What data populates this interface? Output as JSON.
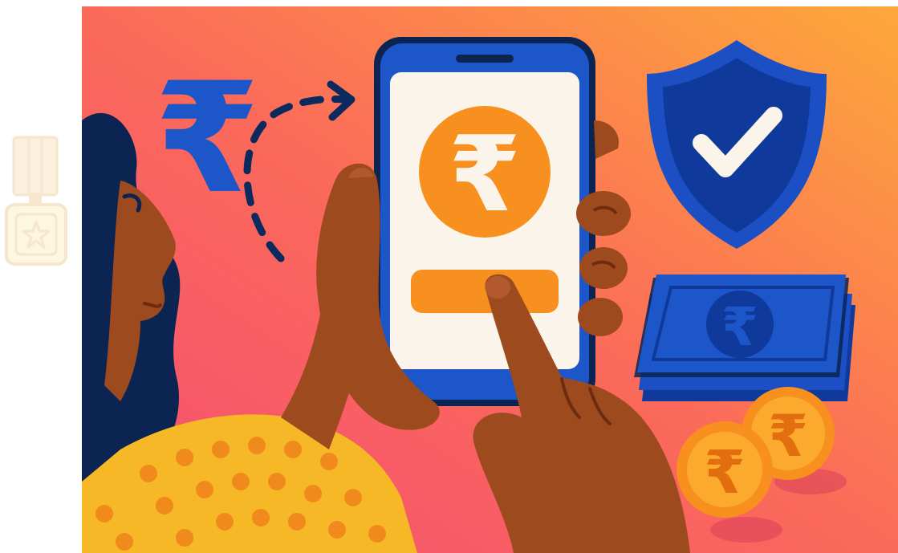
{
  "illustration": {
    "currency_symbol": "₹",
    "icons": {
      "rupee_symbol": "rupee-icon",
      "transfer_arrow": "dashed-arrow-icon",
      "shield_check": "shield-check-icon",
      "banknote_stack": "banknote-stack-icon",
      "coins": "rupee-coin-icon",
      "badge": "medal-badge-icon"
    },
    "colors": {
      "background_start": "#f7556e",
      "background_end": "#fca43c",
      "brand_blue": "#1d4fc4",
      "dark_navy": "#0b2452",
      "orange": "#f7901e",
      "skin": "#9e4a1f",
      "skin_dark": "#7f3716",
      "shirt_yellow": "#f6b826",
      "shirt_dots": "#f08a1c",
      "screen": "#fbf4ea"
    }
  }
}
